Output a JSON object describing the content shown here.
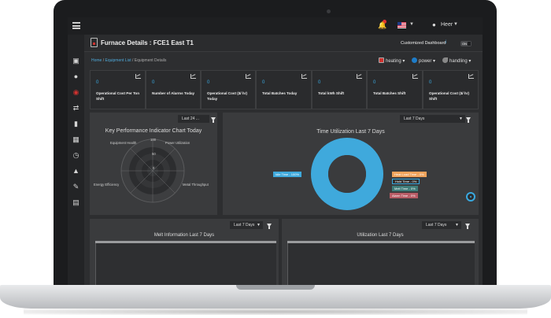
{
  "header": {
    "title": "Furnace Details : FCE1 East T1",
    "customized_dashboard_label": "Customized Dashboard",
    "toggle_label": "ON"
  },
  "user": {
    "name": "Heer"
  },
  "breadcrumb": {
    "home": "Home",
    "sep1": "/",
    "equipment_list": "Equipment List",
    "sep2": "/",
    "current": "Equipment Details"
  },
  "controls": {
    "heating": "heating",
    "power": "power",
    "handling": "handling"
  },
  "kpis": [
    {
      "value": "0",
      "label": "Operational Cost Per Ton Shift"
    },
    {
      "value": "0",
      "label": "Number of Alarms Today"
    },
    {
      "value": "0",
      "label": "Operational Cost ($/ hr) Today"
    },
    {
      "value": "0",
      "label": "Total Batches Today"
    },
    {
      "value": "0",
      "label": "Total kWh Shift"
    },
    {
      "value": "0",
      "label": "Total Batches Shift"
    },
    {
      "value": "0",
      "label": "Operational Cost ($/ hr) Shift"
    }
  ],
  "kpi_panel": {
    "select_label": "Last 24 ...",
    "title": "Key Performance Indicator Chart Today",
    "axis_labels": {
      "top_left": "Equipment Health",
      "top_right": "Power Utilization",
      "left": "Energy Efficiency",
      "right": "Metal Throughput"
    },
    "scale_labels": {
      "outer": "100",
      "mid": "50",
      "center": "0"
    }
  },
  "time_panel": {
    "select_label": "Last 7 Days",
    "title": "Time Utilization Last 7 Days",
    "legend": {
      "idle": "Idle Time - 100%",
      "heat_load": "Heat Load Time - 0%",
      "hold": "Hold Time - 0%",
      "melt": "Melt Time - 0%",
      "alarm": "Alarm Time - 0%"
    }
  },
  "melt_panel": {
    "select_label": "Last 7 Days",
    "title": "Melt Information Last 7 Days"
  },
  "util_panel": {
    "select_label": "Last 7 Days",
    "title": "Utilization Last 7 Days"
  },
  "chart_data": {
    "type": "pie",
    "title": "Time Utilization Last 7 Days",
    "categories": [
      "Idle Time",
      "Heat Load Time",
      "Hold Time",
      "Melt Time",
      "Alarm Time"
    ],
    "values": [
      100,
      0,
      0,
      0,
      0
    ],
    "colors": [
      "#3fa9dc",
      "#f0a35b",
      "#39a9e0",
      "#3e7d7a",
      "#b85c66"
    ]
  },
  "colors": {
    "accent": "#39a9e0",
    "danger": "#d1322f"
  }
}
